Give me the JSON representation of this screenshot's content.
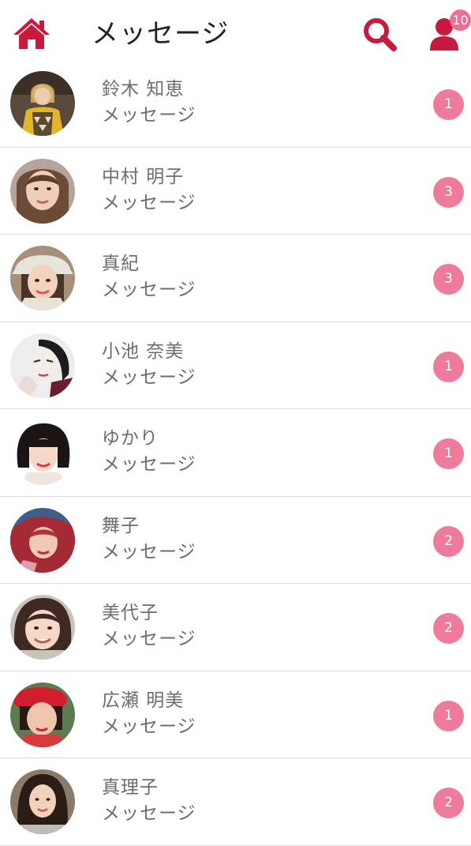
{
  "header": {
    "title": "メッセージ",
    "home_icon": "home-icon",
    "search_icon": "search-icon",
    "profile_icon": "user-icon",
    "notification_count": "10"
  },
  "colors": {
    "accent": "#c8193f",
    "badge": "#ee7b9c",
    "text": "#6d6d6d",
    "divider": "#dcdcdc"
  },
  "conversations": [
    {
      "name": "鈴木 知恵",
      "preview": "メッセージ",
      "unread": "1"
    },
    {
      "name": "中村 明子",
      "preview": "メッセージ",
      "unread": "3"
    },
    {
      "name": "真紀",
      "preview": "メッセージ",
      "unread": "3"
    },
    {
      "name": "小池 奈美",
      "preview": "メッセージ",
      "unread": "1"
    },
    {
      "name": "ゆかり",
      "preview": "メッセージ",
      "unread": "1"
    },
    {
      "name": "舞子",
      "preview": "メッセージ",
      "unread": "2"
    },
    {
      "name": "美代子",
      "preview": "メッセージ",
      "unread": "2"
    },
    {
      "name": "広瀬 明美",
      "preview": "メッセージ",
      "unread": "1"
    },
    {
      "name": "真理子",
      "preview": "メッセージ",
      "unread": "2"
    }
  ]
}
